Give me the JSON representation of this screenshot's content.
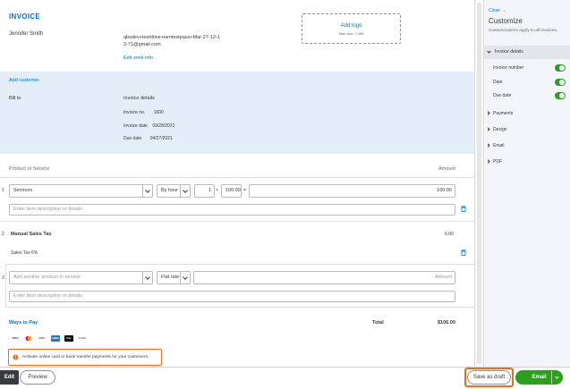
{
  "invoice": {
    "title": "INVOICE",
    "company_name": "Jennifer Smith",
    "email": "qbsdev+testdrive+iamtestpass+Mar-27-12-12-71@gmail.com",
    "edit_work_info": "Edit work info",
    "logo": {
      "label": "Add logo",
      "size_note": "Max size: 1 MB"
    },
    "customer": {
      "add_customer": "Add customer",
      "bill_to": "Bill to",
      "details_heading": "Invoice details",
      "number_label": "Invoice no.",
      "number_value": "1600",
      "date_label": "Invoice date",
      "date_value": "03/28/2021",
      "due_label": "Due date",
      "due_value": "04/27/2021"
    },
    "columns": {
      "product": "Product or Service",
      "amount": "Amount"
    },
    "line1": {
      "num": "1",
      "product": "Services",
      "unit": "By hour",
      "qty": "1",
      "times": "×",
      "rate": "100.00",
      "equals": "=",
      "amount": "100.00",
      "desc_placeholder": "Enter item description or details"
    },
    "line2": {
      "num": "2",
      "name": "Manual Sales Tax",
      "amount": "6.00",
      "tax_label": "Sales Tax 6%"
    },
    "line3": {
      "num": "3",
      "product_placeholder": "Add another product or service",
      "unit": "Flat rate",
      "amount_placeholder": "Amount",
      "desc_placeholder": "Enter item description or details"
    },
    "footer": {
      "ways_to_pay": "Ways to Pay",
      "total_label": "Total",
      "total_value": "$106.00",
      "cards": [
        "VISA",
        "MC",
        "DISC",
        "AMEX",
        "Pay",
        "BANK"
      ],
      "activate_text": "Activate online card or bank transfer payments for your customers."
    }
  },
  "sidebar": {
    "close": "Close →",
    "title": "Customize",
    "subtitle": "Customizations apply to all invoices.",
    "sections": [
      {
        "label": "Invoice details",
        "expanded": true
      },
      {
        "label": "Payments"
      },
      {
        "label": "Design"
      },
      {
        "label": "Email"
      },
      {
        "label": "PDF"
      }
    ],
    "toggles": [
      {
        "label": "Invoice number",
        "on": true
      },
      {
        "label": "Date",
        "on": true
      },
      {
        "label": "Due date",
        "on": true
      }
    ]
  },
  "bottom": {
    "edit": "Edit",
    "preview": "Preview",
    "save_draft": "Save as draft",
    "email": "Email"
  },
  "colors": {
    "accent": "#0077c5",
    "green": "#2ca01c",
    "highlight": "#e8701a"
  }
}
